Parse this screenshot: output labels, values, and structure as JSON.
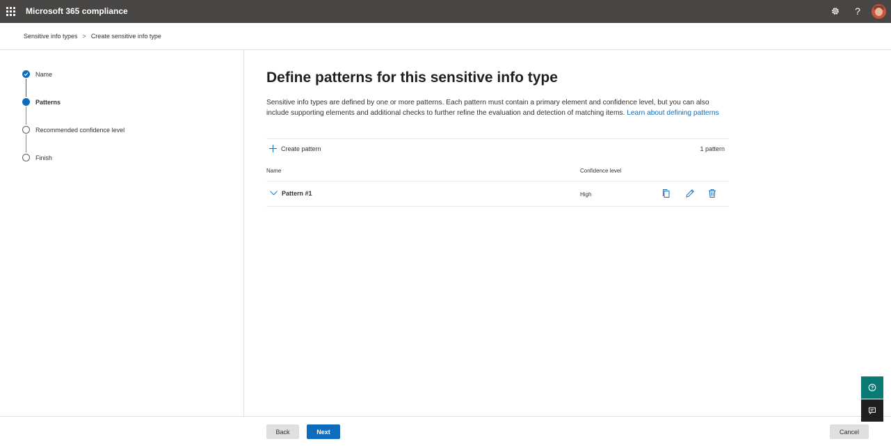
{
  "header": {
    "app_title": "Microsoft 365 compliance",
    "help_glyph": "?"
  },
  "breadcrumb": {
    "items": [
      "Sensitive info types",
      "Create sensitive info type"
    ],
    "separator": ">"
  },
  "wizard": {
    "steps": [
      {
        "label": "Name",
        "state": "completed"
      },
      {
        "label": "Patterns",
        "state": "current"
      },
      {
        "label": "Recommended confidence level",
        "state": "upcoming"
      },
      {
        "label": "Finish",
        "state": "upcoming"
      }
    ]
  },
  "main": {
    "title": "Define patterns for this sensitive info type",
    "description": "Sensitive info types are defined by one or more patterns. Each pattern must contain a primary element and confidence level, but you can also include supporting elements and additional checks to further refine the evaluation and detection of matching items.",
    "learn_link": "Learn about defining patterns",
    "create_pattern_label": "Create pattern",
    "pattern_count": "1 pattern",
    "table": {
      "columns": [
        "Name",
        "Confidence level"
      ],
      "rows": [
        {
          "name": "Pattern #1",
          "confidence": "High"
        }
      ]
    }
  },
  "footer": {
    "back_label": "Back",
    "next_label": "Next",
    "cancel_label": "Cancel"
  },
  "colors": {
    "topbar": "#484644",
    "accent": "#0f6cbd",
    "help_teal": "#0b7a75"
  },
  "icons": [
    "waffle-icon",
    "gear-icon",
    "help-icon",
    "chevron-right-icon",
    "check-icon",
    "plus-icon",
    "chevron-down-icon",
    "copy-icon",
    "edit-icon",
    "delete-icon",
    "question-circle-icon",
    "feedback-icon"
  ]
}
